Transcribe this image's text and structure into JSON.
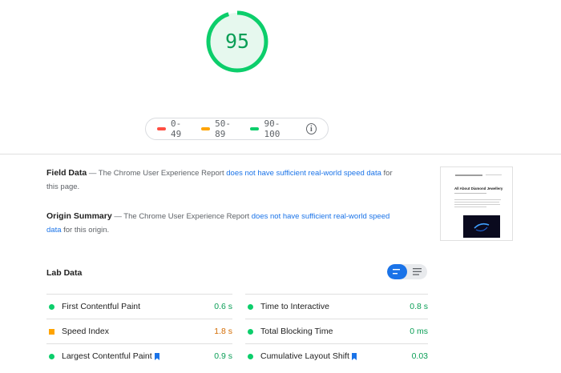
{
  "score": {
    "value": "95",
    "fraction": 0.95,
    "color": "#0cce6b"
  },
  "legend": {
    "items": [
      {
        "label": "0-49",
        "color": "#ff4e42"
      },
      {
        "label": "50-89",
        "color": "#ffa400"
      },
      {
        "label": "90-100",
        "color": "#0cce6b"
      }
    ],
    "info_icon": "info-icon"
  },
  "field_data": {
    "heading": "Field Data",
    "text_before": " — The Chrome User Experience Report ",
    "link": "does not have sufficient real-world speed data",
    "text_after": " for this page."
  },
  "origin_summary": {
    "heading": "Origin Summary",
    "text_before": " — The Chrome User Experience Report ",
    "link": "does not have sufficient real-world speed data",
    "text_after": " for this origin."
  },
  "thumbnail": {
    "title": "All About Diamond Jewellery"
  },
  "lab_data": {
    "title": "Lab Data",
    "metrics_left": [
      {
        "label": "First Contentful Paint",
        "value": "0.6 s",
        "status": "pass"
      },
      {
        "label": "Speed Index",
        "value": "1.8 s",
        "status": "average"
      },
      {
        "label": "Largest Contentful Paint",
        "value": "0.9 s",
        "status": "pass"
      }
    ],
    "metrics_right": [
      {
        "label": "Time to Interactive",
        "value": "0.8 s",
        "status": "pass"
      },
      {
        "label": "Total Blocking Time",
        "value": "0 ms",
        "status": "pass"
      },
      {
        "label": "Cumulative Layout Shift",
        "value": "0.03",
        "status": "pass"
      }
    ]
  },
  "colors": {
    "link": "#1a73e8",
    "pass": "#0cce6b",
    "average": "#ffa400",
    "fail": "#ff4e42"
  }
}
